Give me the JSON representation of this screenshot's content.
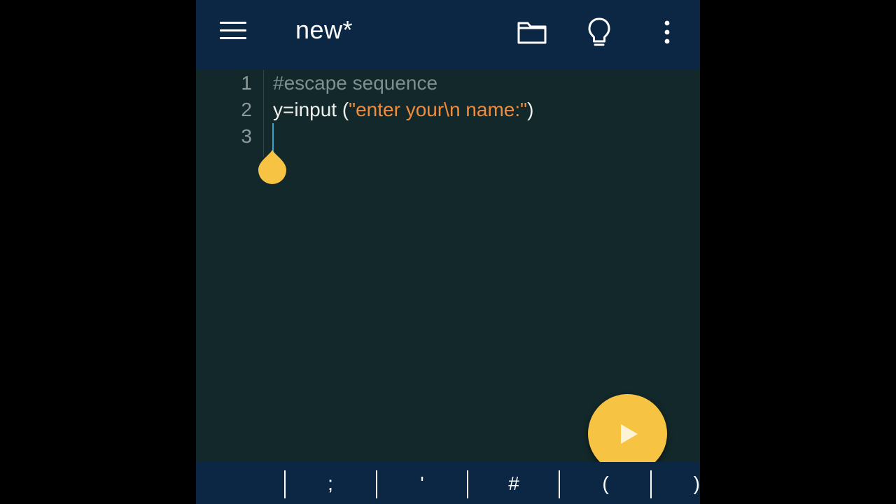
{
  "appbar": {
    "title": "new*",
    "icons": [
      "menu-icon",
      "folder-icon",
      "lightbulb-icon",
      "more-vertical-icon"
    ]
  },
  "editor": {
    "lines": [
      {
        "number": "1",
        "comment": "#escape sequence"
      },
      {
        "number": "2",
        "plain_pre": "y=input (",
        "string": "\"enter your\\n name:\"",
        "plain_post": ")"
      },
      {
        "number": "3",
        "text": ""
      }
    ]
  },
  "run_button": {
    "icon": "play-icon"
  },
  "keybar": {
    "keys": [
      ";",
      "'",
      "#",
      "(",
      ")"
    ]
  },
  "colors": {
    "appbar": "#0b2744",
    "editor_bg": "#13282a",
    "comment": "#7f8f90",
    "string": "#f28c3c",
    "accent": "#f6c342"
  }
}
